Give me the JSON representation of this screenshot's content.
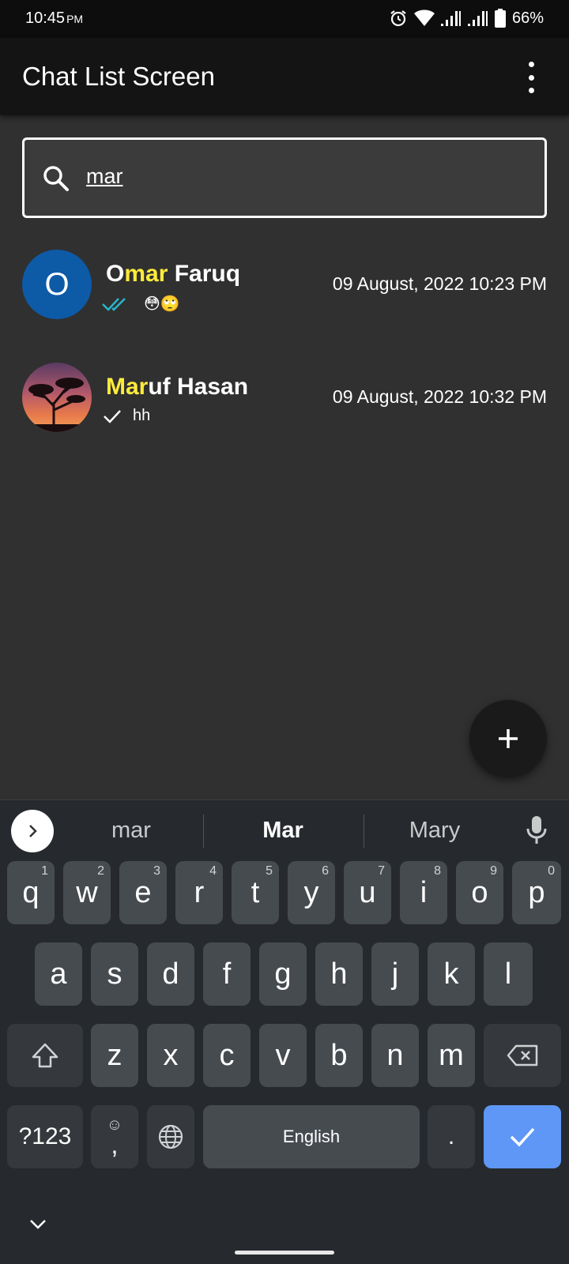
{
  "status_bar": {
    "time": "10:45",
    "ampm": "PM",
    "battery": "66%",
    "icons": [
      "alarm-icon",
      "wifi-icon",
      "signal-icon",
      "signal-icon",
      "battery-icon"
    ]
  },
  "app_bar": {
    "title": "Chat List Screen",
    "menu_icon": "more-vert-icon"
  },
  "search": {
    "value": "mar",
    "icon": "search-icon"
  },
  "chats": [
    {
      "avatar_letter": "O",
      "avatar_color": "#0d5aa7",
      "name_prefix": "O",
      "name_match": "mar",
      "name_suffix": " Faruq",
      "status_icon": "double-check-icon",
      "message": "😳🙄",
      "time": "09 August, 2022 10:23 PM"
    },
    {
      "avatar_image": "sunset-tree-photo",
      "name_prefix": "",
      "name_match": "Mar",
      "name_suffix": "uf Hasan",
      "status_icon": "check-icon",
      "message": "hh",
      "time": "09 August, 2022 10:32 PM"
    }
  ],
  "fab": {
    "icon": "plus-icon"
  },
  "keyboard": {
    "suggestions": [
      "mar",
      "Mar",
      "Mary"
    ],
    "row1": [
      {
        "k": "q",
        "h": "1"
      },
      {
        "k": "w",
        "h": "2"
      },
      {
        "k": "e",
        "h": "3"
      },
      {
        "k": "r",
        "h": "4"
      },
      {
        "k": "t",
        "h": "5"
      },
      {
        "k": "y",
        "h": "6"
      },
      {
        "k": "u",
        "h": "7"
      },
      {
        "k": "i",
        "h": "8"
      },
      {
        "k": "o",
        "h": "9"
      },
      {
        "k": "p",
        "h": "0"
      }
    ],
    "row2": [
      "a",
      "s",
      "d",
      "f",
      "g",
      "h",
      "j",
      "k",
      "l"
    ],
    "row3": [
      "z",
      "x",
      "c",
      "v",
      "b",
      "n",
      "m"
    ],
    "symbols_label": "?123",
    "emoji_label": "☺",
    "comma_label": ",",
    "space_label": "English",
    "period_label": ".",
    "accent_color": "#5e97f6"
  }
}
